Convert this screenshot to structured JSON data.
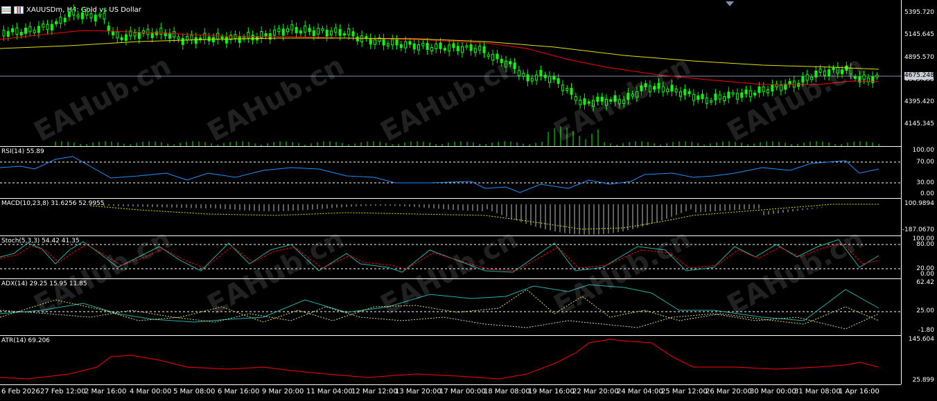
{
  "title": "XAUUSDm, H4:  Gold vs US Dollar",
  "watermark_text": "EAHub.cn",
  "colors": {
    "candle": "#00ff00",
    "ma_red": "#ff0000",
    "ma_yellow": "#e8e000",
    "rsi": "#1e90ff",
    "macd_hist": "#c0c0c0",
    "macd_signal": "#e8e000",
    "stoch_main": "#20b2aa",
    "stoch_signal": "#ff0000",
    "adx": "#20b2aa",
    "atr": "#ff0000",
    "volume": "#00ff00",
    "last_price_line": "#8090b0"
  },
  "main": {
    "price_labels": [
      "5395.720",
      "5145.645",
      "4895.570",
      "4645.495",
      "4395.420",
      "4145.345"
    ],
    "last_price": "4675.248"
  },
  "panes": {
    "rsi": {
      "label": "RSI(14) 55.89",
      "levels": [
        "100.00",
        "70.00",
        "30.00",
        "0.00"
      ]
    },
    "macd": {
      "label": "MACD(10,23,8) 31.6256 52.9955",
      "levels": [
        "100.9894",
        "-187.0670"
      ]
    },
    "stoch": {
      "label": "Stoch(5,3,3) 54.42 41.35",
      "levels": [
        "100.00",
        "80.00",
        "20.00",
        "0.00"
      ]
    },
    "adx": {
      "label": "ADX(14) 29.25 15.95 11.85",
      "levels": [
        "62.42",
        "25.00",
        "-1.80"
      ]
    },
    "atr": {
      "label": "ATR(14) 69.206",
      "levels": [
        "145.604",
        "25.899"
      ]
    }
  },
  "time_labels": [
    "6 Feb 2026",
    "27 Feb 12:00",
    "2 Mar 16:00",
    "4 Mar 00:00",
    "5 Mar 08:00",
    "6 Mar 16:00",
    "9 Mar 20:00",
    "11 Mar 04:00",
    "12 Mar 12:00",
    "13 Mar 20:00",
    "17 Mar 00:00",
    "18 Mar 08:00",
    "19 Mar 16:00",
    "22 Mar 20:00",
    "24 Mar 04:00",
    "25 Mar 12:00",
    "26 Mar 20:00",
    "30 Mar 00:00",
    "31 Mar 08:00",
    "1 Apr 16:00"
  ]
}
